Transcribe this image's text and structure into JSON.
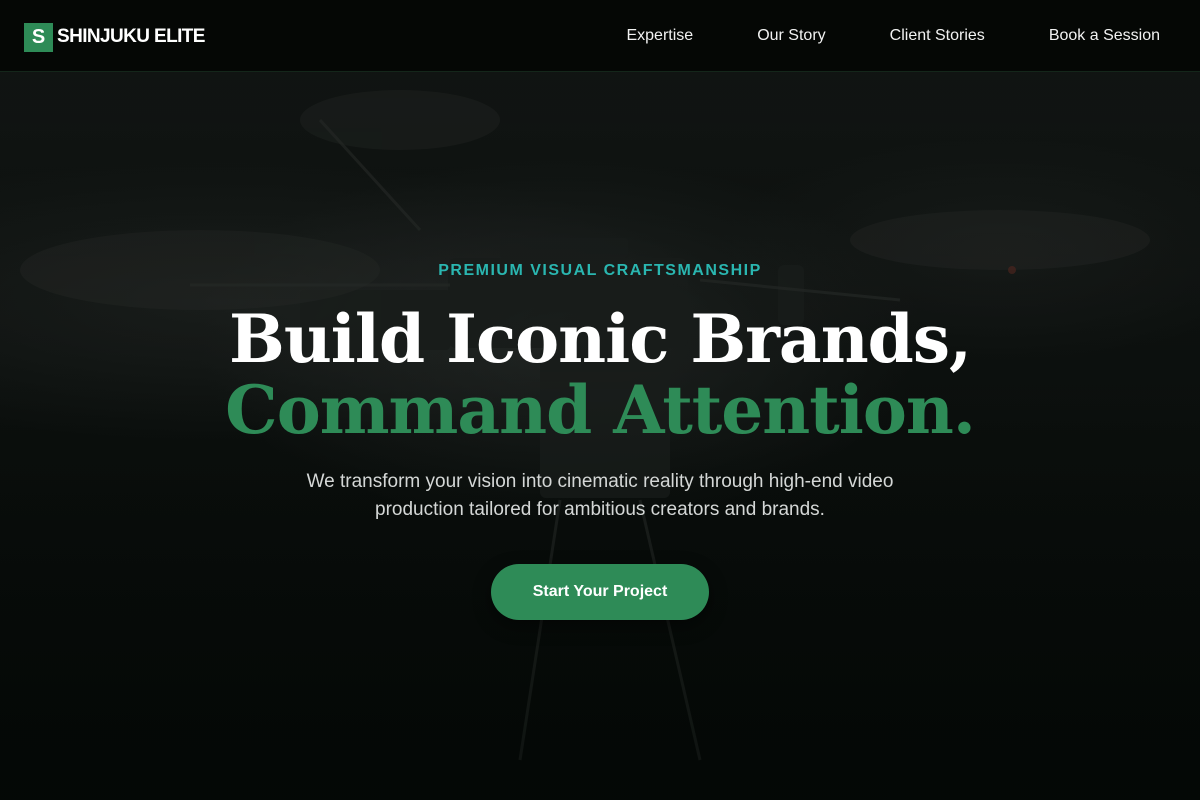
{
  "brand": {
    "mark": "S",
    "name": "SHINJUKU ELITE",
    "accent": "#2e8b57"
  },
  "nav": {
    "items": [
      {
        "label": "Expertise"
      },
      {
        "label": "Our Story"
      },
      {
        "label": "Client Stories"
      },
      {
        "label": "Book a Session"
      }
    ]
  },
  "hero": {
    "eyebrow": "PREMIUM VISUAL CRAFTSMANSHIP",
    "headline_line1": "Build Iconic Brands,",
    "headline_line2": "Command Attention.",
    "subtitle_line1": "We transform your vision into cinematic reality through high-end video",
    "subtitle_line2": "production tailored for ambitious creators and brands.",
    "cta_label": "Start Your Project",
    "eyebrow_color": "#2ab6b0"
  }
}
